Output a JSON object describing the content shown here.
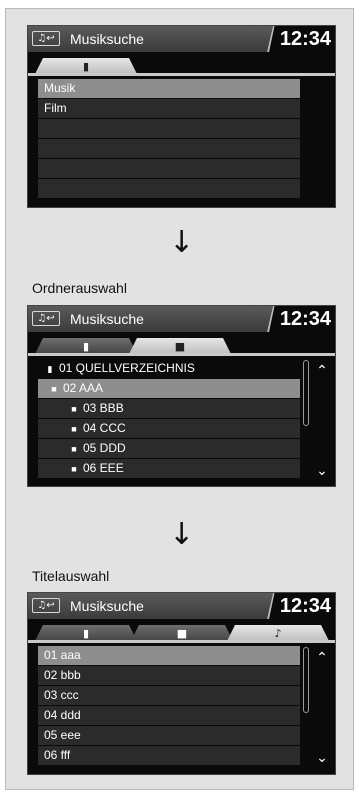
{
  "screens": [
    {
      "header": {
        "source_icon": "♫↩",
        "title": "Musiksuche",
        "clock": "12:34"
      },
      "tabs": [
        {
          "icon": "▮",
          "active": true
        }
      ],
      "rows": [
        {
          "label": "Musik",
          "selected": true
        },
        {
          "label": "Film",
          "selected": false
        },
        {
          "label": "",
          "selected": false
        },
        {
          "label": "",
          "selected": false
        },
        {
          "label": "",
          "selected": false
        },
        {
          "label": "",
          "selected": false
        }
      ]
    },
    {
      "caption": "Ordnerauswahl",
      "header": {
        "source_icon": "♫↩",
        "title": "Musiksuche",
        "clock": "12:34"
      },
      "tabs": [
        {
          "icon": "▮",
          "active": false
        },
        {
          "icon": "■",
          "active": true
        }
      ],
      "rows": [
        {
          "label": "01 QUELLVERZEICHNIS",
          "icon": "▮",
          "selected": false
        },
        {
          "label": "02 AAA",
          "icon": "■",
          "selected": true
        },
        {
          "label": "03 BBB",
          "icon": "■",
          "selected": false
        },
        {
          "label": "04 CCC",
          "icon": "■",
          "selected": false
        },
        {
          "label": "05 DDD",
          "icon": "■",
          "selected": false
        },
        {
          "label": "06 EEE",
          "icon": "■",
          "selected": false
        }
      ],
      "scroll_up": "⌃",
      "scroll_down": "⌄"
    },
    {
      "caption": "Titelauswahl",
      "header": {
        "source_icon": "♫↩",
        "title": "Musiksuche",
        "clock": "12:34"
      },
      "tabs": [
        {
          "icon": "▮",
          "active": false
        },
        {
          "icon": "■",
          "active": false
        },
        {
          "icon": "♪",
          "active": true
        }
      ],
      "rows": [
        {
          "label": "01 aaa",
          "selected": true
        },
        {
          "label": "02 bbb",
          "selected": false
        },
        {
          "label": "03 ccc",
          "selected": false
        },
        {
          "label": "04 ddd",
          "selected": false
        },
        {
          "label": "05 eee",
          "selected": false
        },
        {
          "label": "06 fff",
          "selected": false
        }
      ],
      "scroll_up": "⌃",
      "scroll_down": "⌄"
    }
  ],
  "flow_arrow": "↓",
  "colors": {
    "selected_row": "#8e8e8e",
    "row": "#2b2b2b",
    "screen_bg": "#0a0a0a",
    "page_bg": "#e2e2e2"
  }
}
